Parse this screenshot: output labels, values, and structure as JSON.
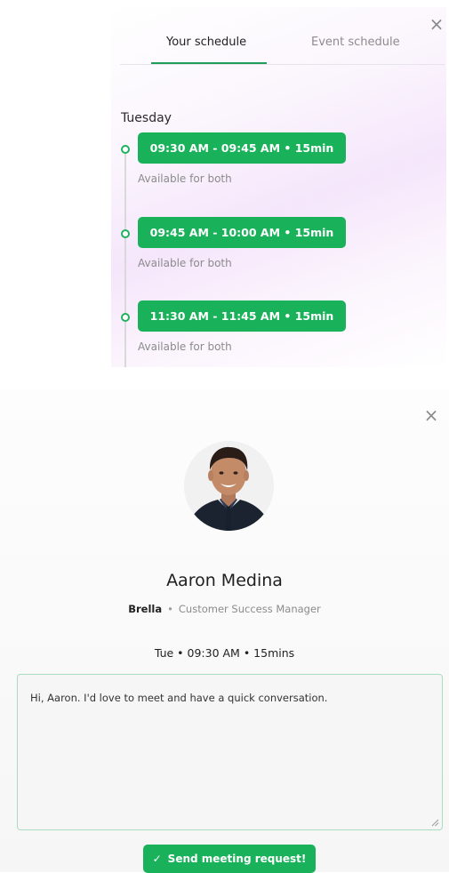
{
  "schedule_panel": {
    "close_icon": "close-icon",
    "tabs": [
      {
        "label": "Your schedule",
        "active": true
      },
      {
        "label": "Event schedule",
        "active": false
      }
    ],
    "day": "Tuesday",
    "slots": [
      {
        "time": "09:30 AM - 09:45 AM • 15min",
        "availability": "Available for both"
      },
      {
        "time": "09:45 AM - 10:00 AM • 15min",
        "availability": "Available for both"
      },
      {
        "time": "11:30 AM - 11:45 AM • 15min",
        "availability": "Available for both"
      }
    ]
  },
  "request_panel": {
    "close_icon": "close-icon",
    "person": {
      "name": "Aaron Medina",
      "company": "Brella",
      "separator": "•",
      "role": "Customer Success Manager"
    },
    "meeting_time": "Tue • 09:30 AM • 15mins",
    "message": "Hi, Aaron. I'd love to meet and have a quick conversation.",
    "send_button": {
      "icon": "check-icon",
      "label": "Send meeting request!"
    }
  },
  "colors": {
    "accent": "#19b25a",
    "tab_underline": "#1e9e5a",
    "muted_text": "#8b8b8b",
    "message_border": "#a9dcc0"
  }
}
